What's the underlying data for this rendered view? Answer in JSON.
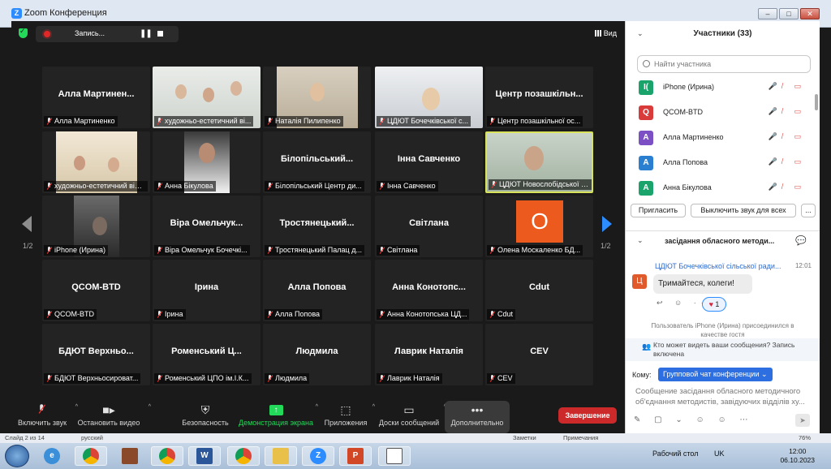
{
  "window": {
    "title": "Zoom Конференция"
  },
  "topbar": {
    "recording_label": "Запись...",
    "view_label": "Вид"
  },
  "tiles": [
    {
      "name": "Алла Мартинен...",
      "label": "Алла Мартиненко",
      "photo": false
    },
    {
      "name": "",
      "label": "художньо-естетичний ві...",
      "photo": true
    },
    {
      "name": "",
      "label": "Наталія Пилипенко",
      "photo": true
    },
    {
      "name": "",
      "label": "ЦДЮТ Бочечківської с...",
      "photo": true
    },
    {
      "name": "Центр позашкільн...",
      "label": "Центр позашкільної ос...",
      "photo": false
    },
    {
      "name": "",
      "label": "художньо-естетичний відді...",
      "photo": true
    },
    {
      "name": "",
      "label": "Анна Бікулова",
      "photo": true
    },
    {
      "name": "Білопільський...",
      "label": "Білопільський Центр ди...",
      "photo": false
    },
    {
      "name": "Інна Савченко",
      "label": "Інна Савченко",
      "photo": false
    },
    {
      "name": "",
      "label": "ЦДЮТ Новослобідської сі...",
      "photo": true
    },
    {
      "name": "",
      "label": "iPhone (Ирина)",
      "photo": true
    },
    {
      "name": "Віра Омельчук...",
      "label": "Віра Омельчук Бочечкі...",
      "photo": false
    },
    {
      "name": "Тростянецький...",
      "label": "Тростянецький Палац д...",
      "photo": false
    },
    {
      "name": "Світлана",
      "label": "Світлана",
      "photo": false
    },
    {
      "name": "O",
      "label": "Олена Москаленко БД...",
      "photo": false
    },
    {
      "name": "QCOM-BTD",
      "label": "QCOM-BTD",
      "photo": false
    },
    {
      "name": "Ірина",
      "label": "Ірина",
      "photo": false
    },
    {
      "name": "Алла Попова",
      "label": "Алла Попова",
      "photo": false
    },
    {
      "name": "Анна Конотопс...",
      "label": "Анна Конотопська ЦД...",
      "photo": false
    },
    {
      "name": "Cdut",
      "label": "Cdut",
      "photo": false
    },
    {
      "name": "БДЮТ Верхньо...",
      "label": "БДЮТ Верхньосироват...",
      "photo": false
    },
    {
      "name": "Роменський Ц...",
      "label": "Роменський ЦПО ім.І.К...",
      "photo": false
    },
    {
      "name": "Людмила",
      "label": "Людмила",
      "photo": false
    },
    {
      "name": "Лаврик Наталія",
      "label": "Лаврик Наталія",
      "photo": false
    },
    {
      "name": "CEV",
      "label": "CEV",
      "photo": false
    }
  ],
  "pages": {
    "left": "1/2",
    "right": "1/2"
  },
  "toolbar": {
    "mute": "Включить звук",
    "video": "Остановить видео",
    "security": "Безопасность",
    "share": "Демонстрация экрана",
    "apps": "Приложения",
    "whiteboard": "Доски сообщений",
    "more": "Дополнительно",
    "end": "Завершение"
  },
  "panel": {
    "title": "Участники (33)",
    "search_placeholder": "Найти участника",
    "participants": [
      {
        "initial": "I(",
        "name": "iPhone (Ирина)",
        "color": "#1aa36b"
      },
      {
        "initial": "Q",
        "name": "QCOM-BTD",
        "color": "#d93a3a"
      },
      {
        "initial": "А",
        "name": "Алла Мартиненко",
        "color": "#7c4fc4"
      },
      {
        "initial": "А",
        "name": "Алла Попова",
        "color": "#2b7fd1"
      },
      {
        "initial": "А",
        "name": "Анна Бікулова",
        "color": "#1aa36b"
      }
    ],
    "invite": "Пригласить",
    "mute_all": "Выключить звук для всех",
    "more": "..."
  },
  "chat": {
    "title": "засідання обласного методи...",
    "sender": "ЦДЮТ Бочечківської сільської ради...",
    "time": "12:01",
    "avatar": "Ц",
    "message": "Тримайтеся, колеги!",
    "reaction_count": "1",
    "system": "Пользователь iPhone (Ирина) присоединился в качестве гостя",
    "who_can_see": "Кто может видеть ваши сообщения? Запись включена",
    "to_label": "Кому:",
    "to_value": "Групповой чат конференции ⌄",
    "compose": "Сообщение засідання обласного методичного об'єднання методистів, завідуючих відділів ху..."
  },
  "statusbar": {
    "slide": "Слайд 2 из 14",
    "lang": "русский",
    "notes": "Заметки",
    "comments": "Примечания",
    "zoom": "76%"
  },
  "taskbar": {
    "desktop": "Рабочий стол",
    "lang": "UK",
    "time": "12:00",
    "date": "06.10.2023"
  }
}
